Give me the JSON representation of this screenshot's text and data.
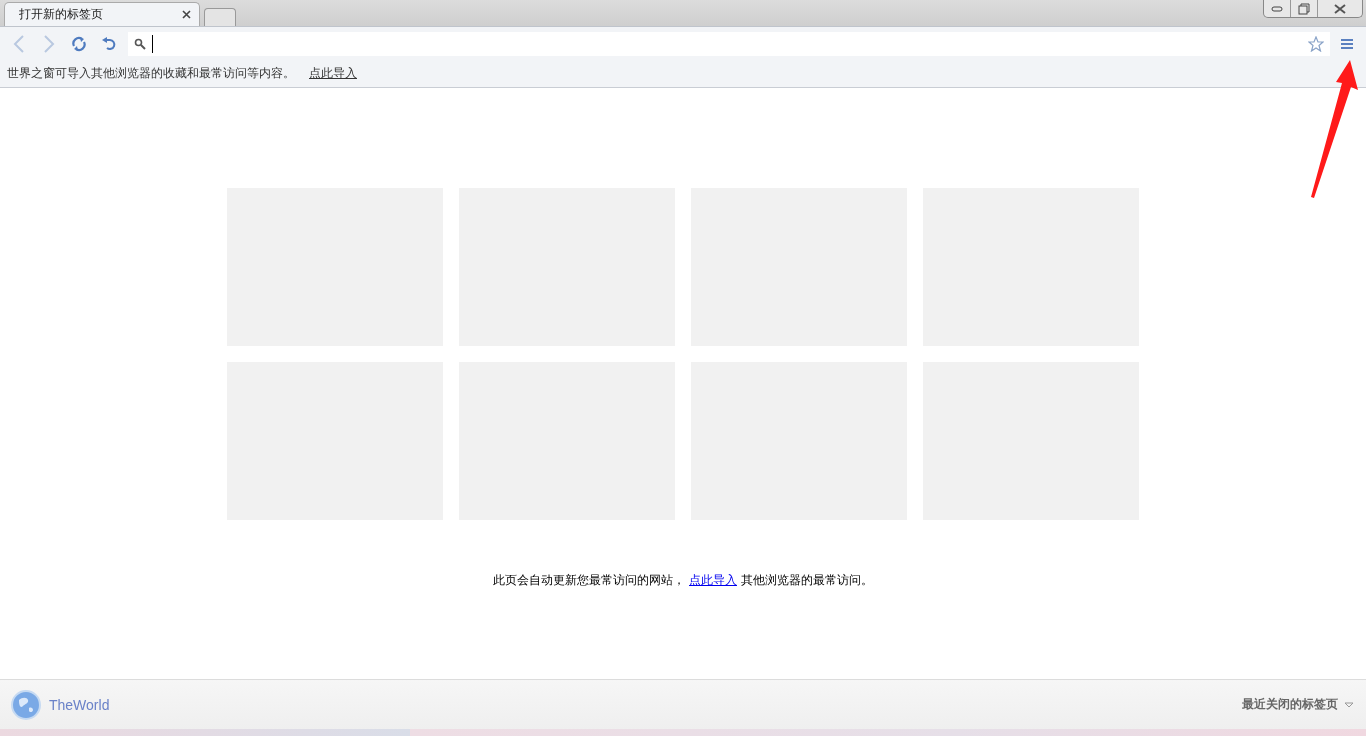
{
  "tabs": [
    {
      "title": "打开新的标签页",
      "selected": true
    }
  ],
  "info_bar": {
    "text": "世界之窗可导入其他浏览器的收藏和最常访问等内容。",
    "link": "点此导入"
  },
  "tiles": [
    {
      "kind": "empty"
    },
    {
      "kind": "empty"
    },
    {
      "kind": "empty"
    },
    {
      "kind": "empty"
    },
    {
      "kind": "empty"
    },
    {
      "kind": "empty"
    },
    {
      "kind": "empty"
    },
    {
      "kind": "empty"
    }
  ],
  "notice": {
    "before": "此页会自动更新您最常访问的网站，",
    "link": "点此导入",
    "after": "其他浏览器的最常访问。"
  },
  "footer": {
    "brand": "TheWorld",
    "recent": "最近关闭的标签页"
  }
}
